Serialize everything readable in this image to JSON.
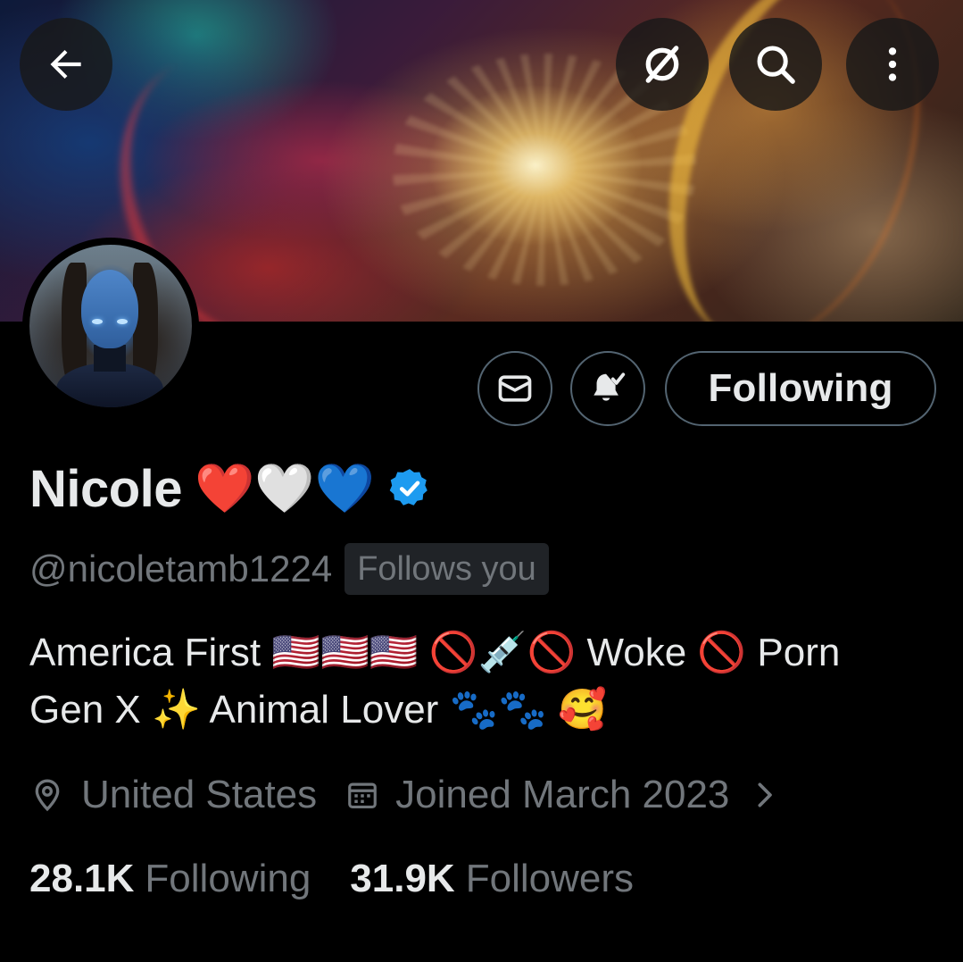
{
  "header": {
    "back_icon": "arrow-left-icon",
    "grok_icon": "slashed-circle-icon",
    "search_icon": "search-icon",
    "more_icon": "more-vertical-icon"
  },
  "profile": {
    "name": "Nicole",
    "name_emojis": "❤️🤍💙",
    "verified": true,
    "handle": "@nicoletamb1224",
    "follows_you_label": "Follows you",
    "bio_line1": "America First 🇺🇸🇺🇸🇺🇸 🚫💉🚫 Woke 🚫 Porn",
    "bio_line2": "Gen X ✨ Animal Lover 🐾🐾 🥰",
    "location": "United States",
    "joined": "Joined March 2023",
    "following_count": "28.1K",
    "following_label": "Following",
    "followers_count": "31.9K",
    "followers_label": "Followers"
  },
  "actions": {
    "message_icon": "envelope-icon",
    "notify_icon": "bell-check-icon",
    "following_button": "Following"
  },
  "colors": {
    "background": "#000000",
    "text_primary": "#e7e9ea",
    "text_secondary": "#71767b",
    "border": "#536471",
    "verified_blue": "#1d9bf0"
  }
}
